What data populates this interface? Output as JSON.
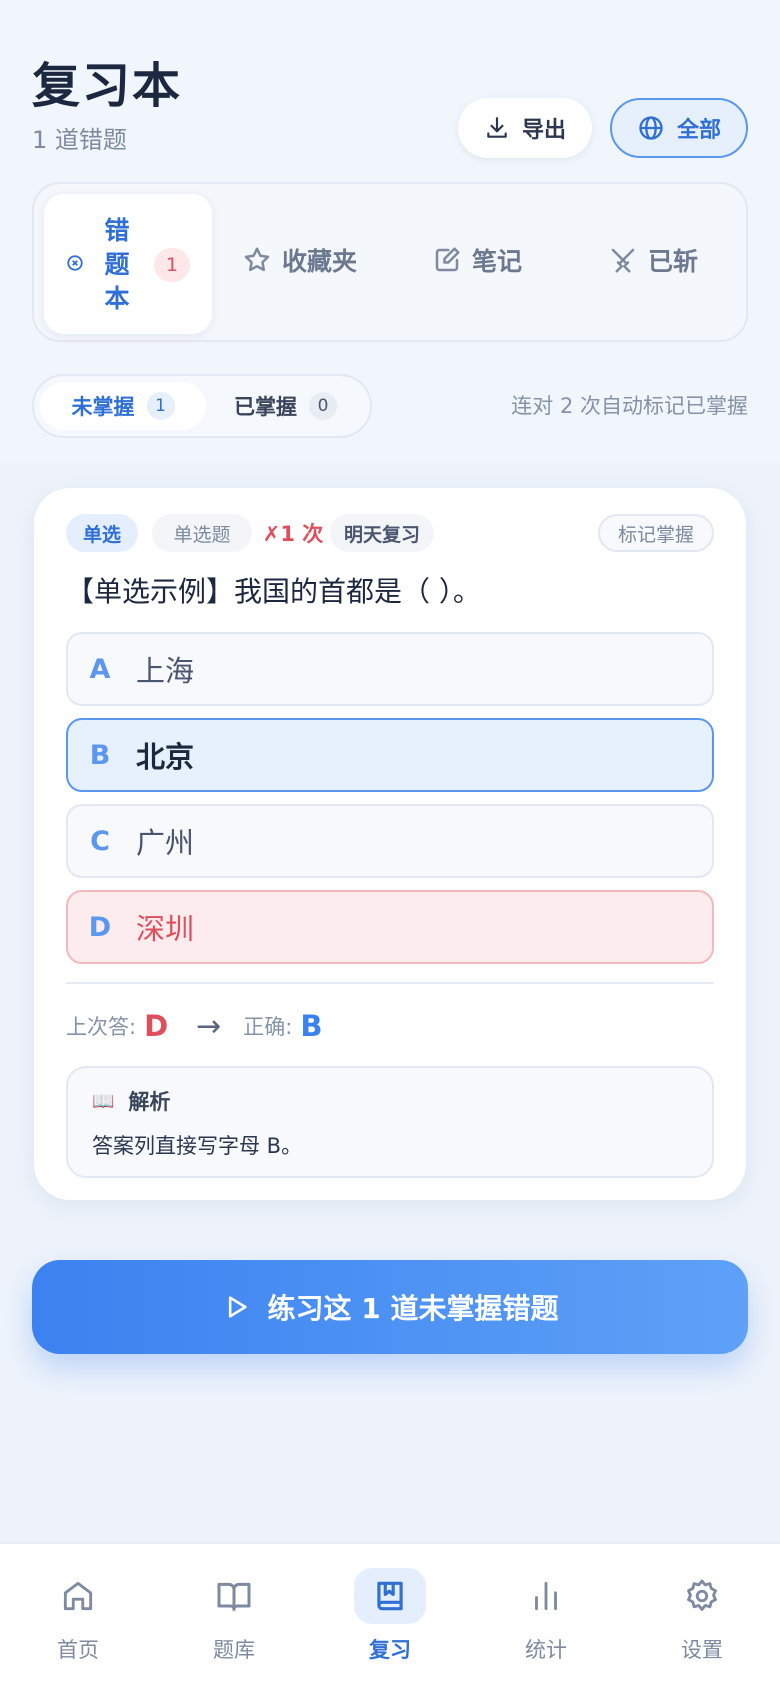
{
  "header": {
    "title": "复习本",
    "subtitle": "1 道错题",
    "export_label": "导出",
    "filter_label": "全部"
  },
  "tabs": [
    {
      "label": "错题本",
      "badge": "1",
      "active": true
    },
    {
      "label": "收藏夹"
    },
    {
      "label": "笔记"
    },
    {
      "label": "已斩"
    }
  ],
  "mastery_filter": {
    "unmastered_label": "未掌握",
    "unmastered_count": "1",
    "mastered_label": "已掌握",
    "mastered_count": "0",
    "hint": "连对 2 次自动标记已掌握"
  },
  "question": {
    "type_tag": "单选",
    "sub_tag": "单选题",
    "wrong_count": "✗1 次",
    "review_tag": "明天复习",
    "mark_label": "标记掌握",
    "text": "【单选示例】我国的首都是（ ）。",
    "options": [
      {
        "letter": "A",
        "text": "上海",
        "state": "normal"
      },
      {
        "letter": "B",
        "text": "北京",
        "state": "correct"
      },
      {
        "letter": "C",
        "text": "广州",
        "state": "normal"
      },
      {
        "letter": "D",
        "text": "深圳",
        "state": "wrong"
      }
    ],
    "last_answer_label": "上次答:",
    "last_answer": "D",
    "arrow": "→",
    "correct_label": "正确:",
    "correct_answer": "B",
    "analysis_icon": "📖",
    "analysis_title": "解析",
    "analysis_text": "答案列直接写字母 B。"
  },
  "practice_button": "练习这 1 道未掌握错题",
  "bottom_nav": [
    {
      "label": "首页",
      "icon": "home-icon"
    },
    {
      "label": "题库",
      "icon": "book-open-icon"
    },
    {
      "label": "复习",
      "icon": "bookmark-book-icon",
      "active": true
    },
    {
      "label": "统计",
      "icon": "bar-chart-icon"
    },
    {
      "label": "设置",
      "icon": "gear-icon"
    }
  ],
  "colors": {
    "accent": "#2f6fd6",
    "accent_light": "#5b97ee",
    "error": "#e04e5c",
    "background": "#eef3fb"
  }
}
